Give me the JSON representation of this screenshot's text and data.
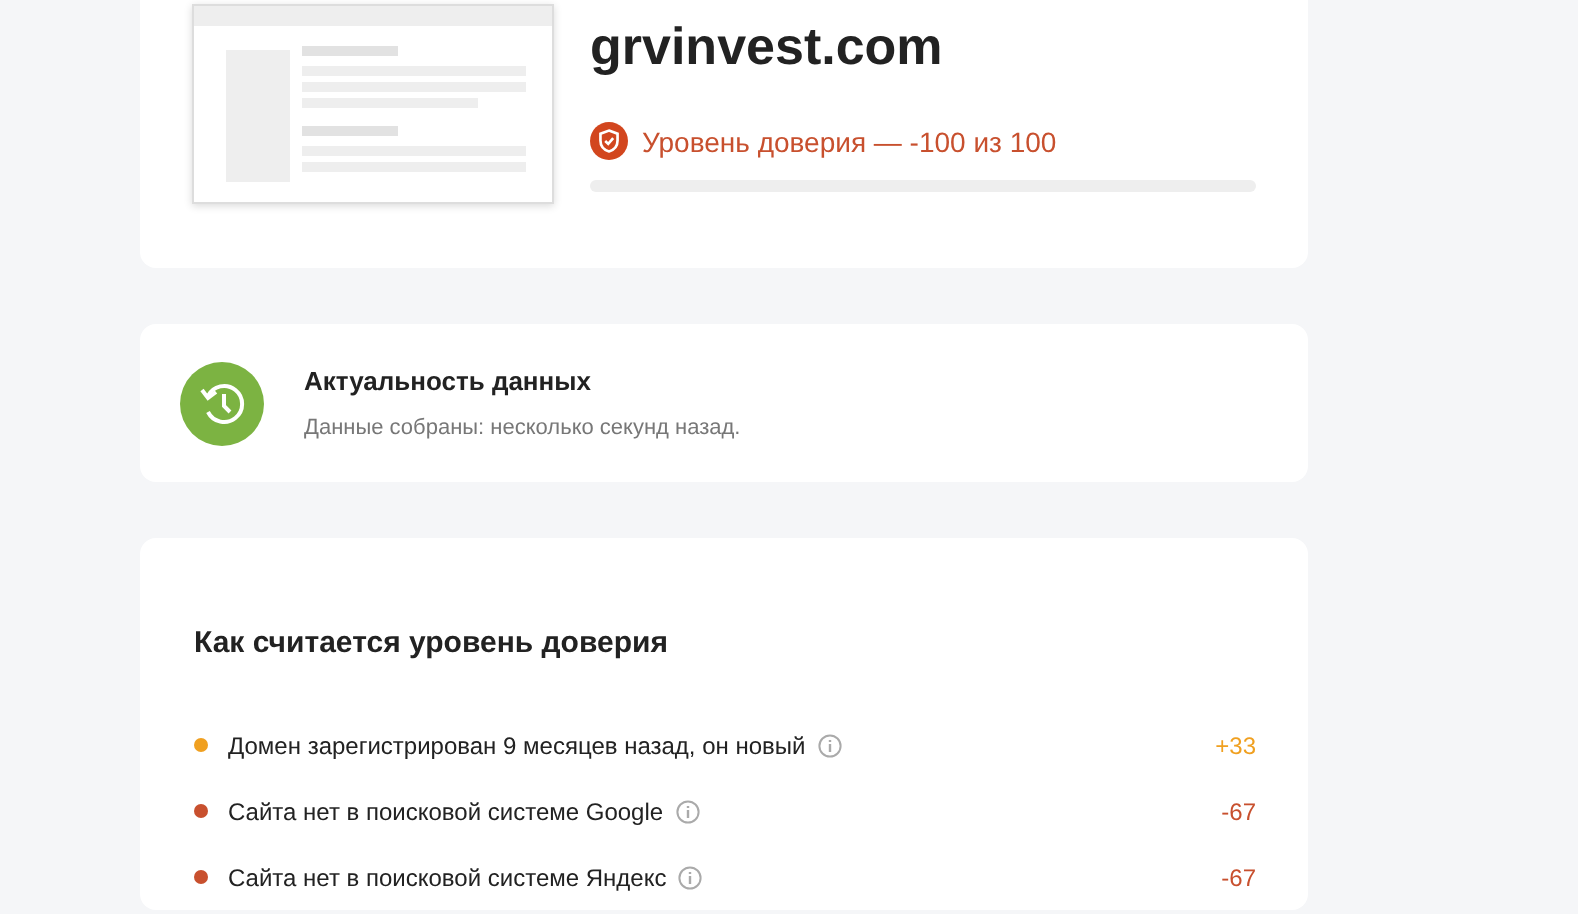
{
  "site": {
    "domain": "grvinvest.com",
    "trust_label": "Уровень доверия — -100 из 100"
  },
  "freshness": {
    "title": "Актуальность данных",
    "subtitle": "Данные собраны: несколько секунд назад."
  },
  "trust_breakdown": {
    "title": "Как считается уровень доверия",
    "items": [
      {
        "text": "Домен зарегистрирован 9 месяцев назад, он новый",
        "score": "+33",
        "color": "#f0a020"
      },
      {
        "text": "Сайта нет в поисковой системе Google",
        "score": "-67",
        "color": "#c8502e"
      },
      {
        "text": "Сайта нет в поисковой системе Яндекс",
        "score": "-67",
        "color": "#c8502e"
      }
    ]
  }
}
